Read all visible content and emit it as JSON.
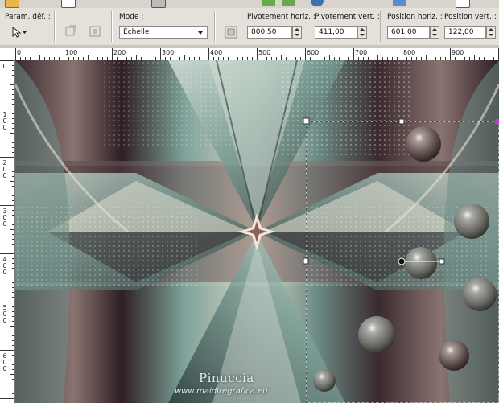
{
  "options": {
    "preset_label": "Param. déf. :",
    "mode_label": "Mode :",
    "mode_value": "Échelle",
    "pivot_h_label": "Pivotement horiz. :",
    "pivot_h_value": "800,50",
    "pivot_v_label": "Pivotement vert. :",
    "pivot_v_value": "411,00",
    "pos_h_label": "Position horiz. :",
    "pos_h_value": "601,00",
    "pos_v_label": "Position vert. :",
    "pos_v_value": "122,00"
  },
  "ruler": {
    "h_labels": [
      "0",
      "100",
      "200",
      "300",
      "400",
      "500",
      "600",
      "700",
      "800",
      "900"
    ],
    "v_labels": [
      "0",
      "1\n0\n0",
      "2\n0\n0",
      "3\n0\n0",
      "4\n0\n0",
      "5\n0\n0",
      "6\n0\n0"
    ]
  },
  "watermark": {
    "name": "Pinuccia",
    "url": "www.maidiregrafica.eu"
  },
  "colors": {
    "teal": "#7fa39a",
    "mauve": "#8a6f6e",
    "dark": "#2e1f24",
    "cream": "#d9d3c2"
  }
}
